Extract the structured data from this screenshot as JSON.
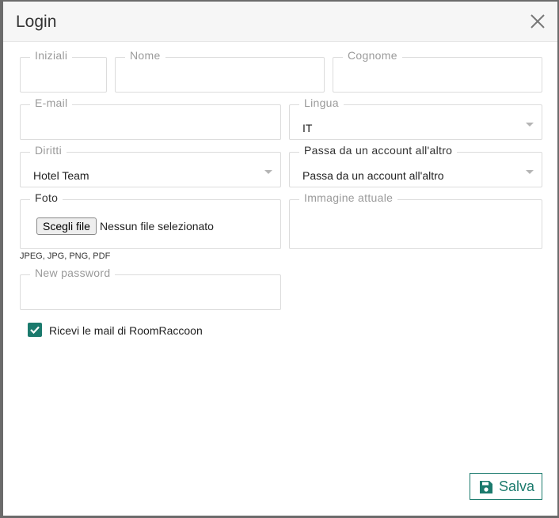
{
  "modal": {
    "title": "Login"
  },
  "fields": {
    "iniziali": {
      "label": "Iniziali",
      "value": ""
    },
    "nome": {
      "label": "Nome",
      "value": ""
    },
    "cognome": {
      "label": "Cognome",
      "value": ""
    },
    "email": {
      "label": "E-mail",
      "value": ""
    },
    "lingua": {
      "label": "Lingua",
      "value": "IT"
    },
    "diritti": {
      "label": "Diritti",
      "value": "Hotel Team"
    },
    "passa": {
      "label": "Passa da un account all'altro",
      "value": "Passa da un account all'altro"
    },
    "foto": {
      "label": "Foto",
      "button": "Scegli file",
      "status": "Nessun file selezionato"
    },
    "immagine": {
      "label": "Immagine attuale"
    },
    "password": {
      "label": "New password",
      "value": ""
    }
  },
  "file_hint": "JPEG, JPG, PNG, PDF",
  "checkbox": {
    "label": "Ricevi le mail di RoomRaccoon",
    "checked": true
  },
  "save_label": "Salva",
  "colors": {
    "accent": "#1b7a6d"
  }
}
